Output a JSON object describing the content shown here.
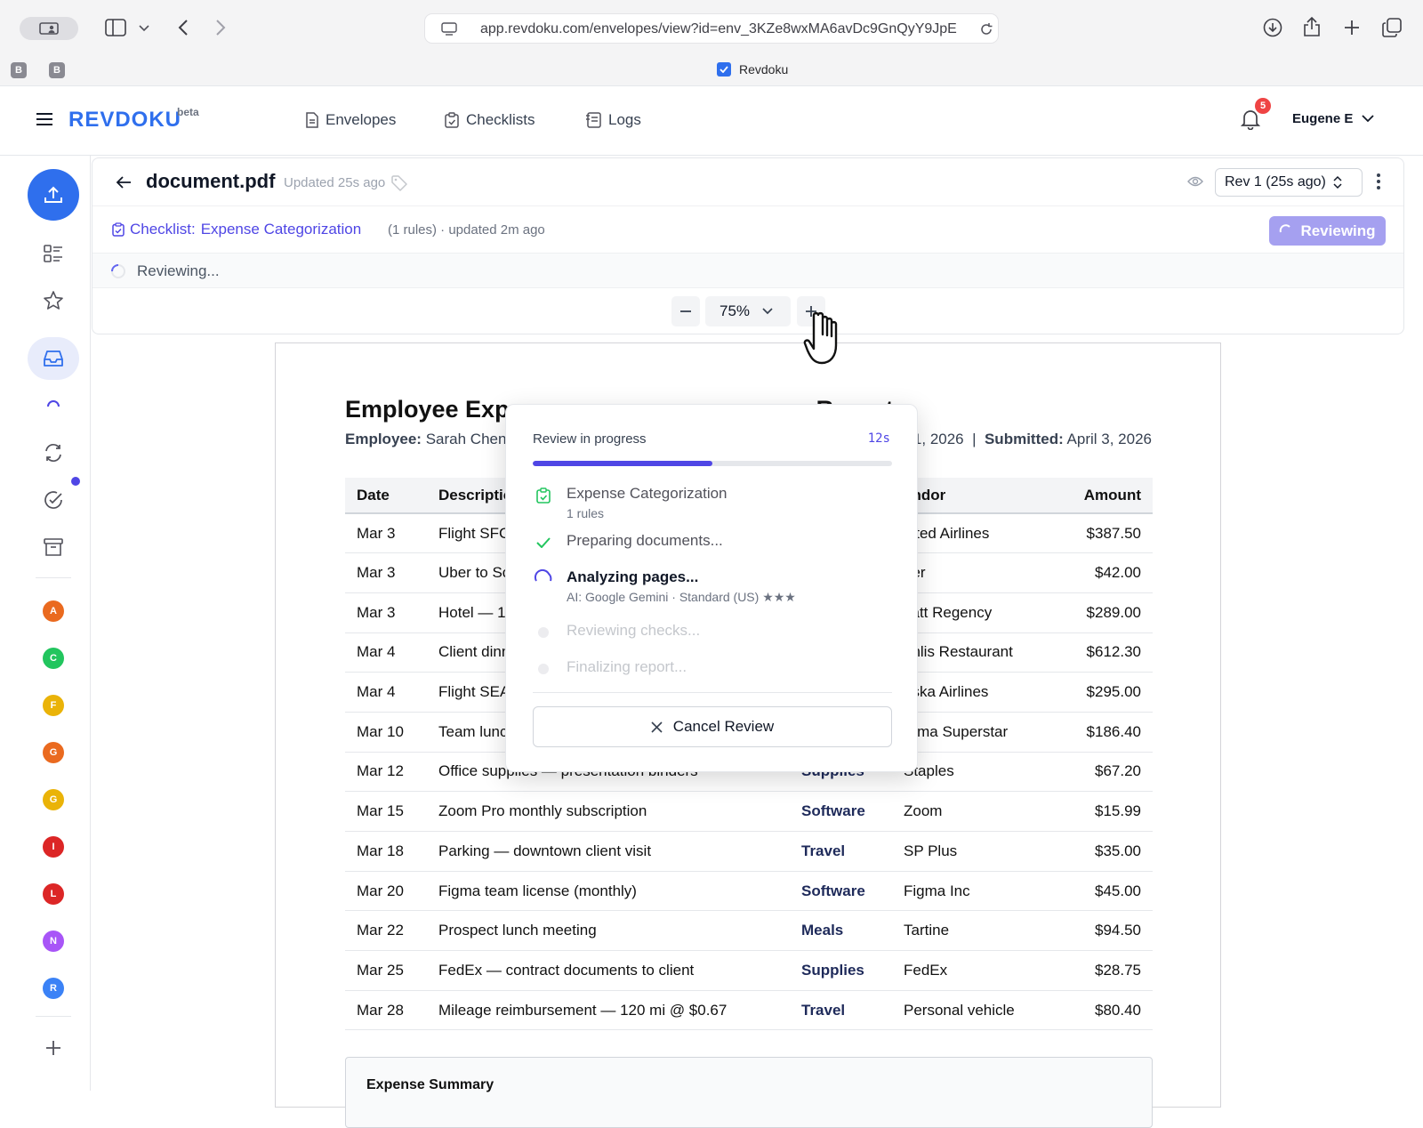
{
  "browser": {
    "url": "app.revdoku.com/envelopes/view?id=env_3KZe8wxMA6avDc9GnQyY9JpE",
    "tab_title": "Revdoku",
    "pinned_tabs": [
      "B",
      "B"
    ]
  },
  "app": {
    "brand": "REVDOKU",
    "brand_tag": "beta",
    "nav": [
      {
        "label": "Envelopes",
        "icon": "document-icon"
      },
      {
        "label": "Checklists",
        "icon": "clipboard-check-icon"
      },
      {
        "label": "Logs",
        "icon": "logs-icon"
      }
    ],
    "notifications_count": "5",
    "user_name": "Eugene E"
  },
  "rail": {
    "avatars": [
      {
        "letter": "A",
        "color": "#ea6a1f"
      },
      {
        "letter": "C",
        "color": "#22c55e"
      },
      {
        "letter": "F",
        "color": "#eab308"
      },
      {
        "letter": "G",
        "color": "#ea6a1f"
      },
      {
        "letter": "G",
        "color": "#eab308"
      },
      {
        "letter": "I",
        "color": "#dc2626"
      },
      {
        "letter": "L",
        "color": "#dc2626"
      },
      {
        "letter": "N",
        "color": "#a855f7"
      },
      {
        "letter": "R",
        "color": "#3b82f6"
      }
    ]
  },
  "document": {
    "title": "document.pdf",
    "updated": "Updated 25s ago",
    "revision": "Rev 1 (25s ago)",
    "checklist_prefix": "Checklist:",
    "checklist_name": "Expense Categorization",
    "checklist_meta": "(1 rules) · updated 2m ago",
    "review_button": "Reviewing",
    "status": "Reviewing...",
    "zoom": "75%"
  },
  "report": {
    "title_visible": "Employee Expe",
    "title_tail": "Report",
    "employee_label": "Employee:",
    "employee_name": "Sarah Chen",
    "date_tail": "1, 2026",
    "submitted_label": "Submitted:",
    "submitted_date": "April 3, 2026",
    "columns": [
      "Date",
      "Descriptio",
      "",
      "endor",
      "Amount"
    ],
    "rows": [
      {
        "date": "Mar 3",
        "desc": "Flight SFC",
        "cat": "",
        "vendor": "nited Airlines",
        "amount": "$387.50"
      },
      {
        "date": "Mar 3",
        "desc": "Uber to Sc",
        "cat": "",
        "vendor": "ber",
        "amount": "$42.00"
      },
      {
        "date": "Mar 3",
        "desc": "Hotel — 1",
        "cat": "",
        "vendor": "yatt Regency",
        "amount": "$289.00"
      },
      {
        "date": "Mar 4",
        "desc": "Client dinn",
        "cat": "",
        "vendor": "anlis Restaurant",
        "amount": "$612.30"
      },
      {
        "date": "Mar 4",
        "desc": "Flight SEA",
        "cat": "",
        "vendor": "aska Airlines",
        "amount": "$295.00"
      },
      {
        "date": "Mar 10",
        "desc": "Team lunc",
        "cat": "",
        "vendor": "urma Superstar",
        "amount": "$186.40"
      },
      {
        "date": "Mar 12",
        "desc": "Office supplies — presentation binders",
        "cat": "Supplies",
        "vendor": "Staples",
        "amount": "$67.20"
      },
      {
        "date": "Mar 15",
        "desc": "Zoom Pro monthly subscription",
        "cat": "Software",
        "vendor": "Zoom",
        "amount": "$15.99"
      },
      {
        "date": "Mar 18",
        "desc": "Parking — downtown client visit",
        "cat": "Travel",
        "vendor": "SP Plus",
        "amount": "$35.00"
      },
      {
        "date": "Mar 20",
        "desc": "Figma team license (monthly)",
        "cat": "Software",
        "vendor": "Figma Inc",
        "amount": "$45.00"
      },
      {
        "date": "Mar 22",
        "desc": "Prospect lunch meeting",
        "cat": "Meals",
        "vendor": "Tartine",
        "amount": "$94.50"
      },
      {
        "date": "Mar 25",
        "desc": "FedEx — contract documents to client",
        "cat": "Supplies",
        "vendor": "FedEx",
        "amount": "$28.75"
      },
      {
        "date": "Mar 28",
        "desc": "Mileage reimbursement — 120 mi @ $0.67",
        "cat": "Travel",
        "vendor": "Personal vehicle",
        "amount": "$80.40"
      }
    ],
    "summary_title": "Expense Summary"
  },
  "review_popup": {
    "title": "Review in progress",
    "elapsed": "12s",
    "progress": 0.5,
    "checklist_name": "Expense Categorization",
    "checklist_rules": "1 rules",
    "steps": [
      {
        "label": "Preparing documents...",
        "state": "done"
      },
      {
        "label": "Analyzing pages...",
        "state": "active",
        "sub": "AI: Google Gemini · Standard (US) ★★★"
      },
      {
        "label": "Reviewing checks...",
        "state": "pending"
      },
      {
        "label": "Finalizing report...",
        "state": "pending"
      }
    ],
    "cancel_label": "Cancel Review"
  }
}
